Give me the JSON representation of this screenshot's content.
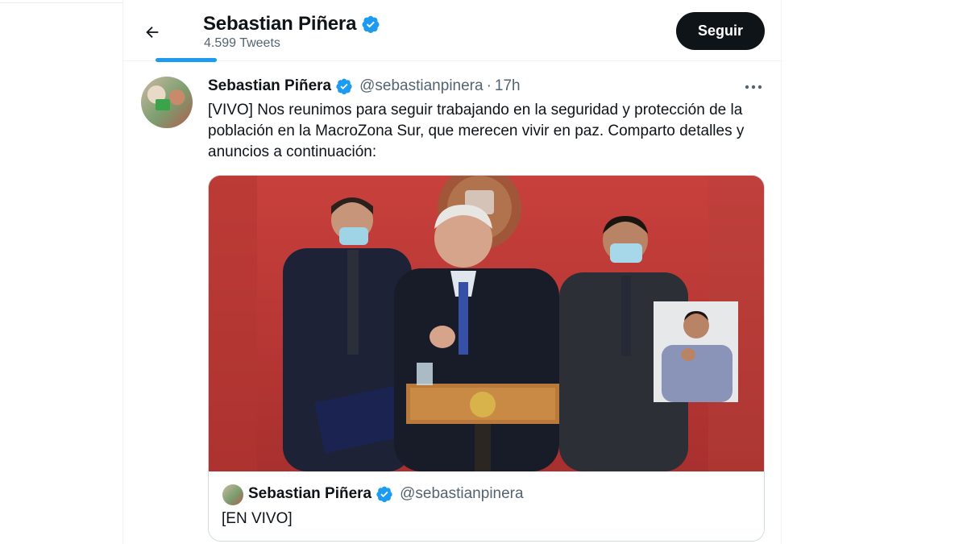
{
  "header": {
    "name": "Sebastian Piñera",
    "tweet_count": "4.599 Tweets",
    "follow_label": "Seguir",
    "back_icon": "arrow-left-icon",
    "verified_icon": "verified-badge-icon"
  },
  "tweet": {
    "author_name": "Sebastian Piñera",
    "handle": "@sebastianpinera",
    "separator": "·",
    "time": "17h",
    "more_icon": "more-horizontal-icon",
    "text": "[VIVO] Nos reunimos para seguir trabajando en la seguridad y protección de la población en la MacroZona Sur, que merecen vivir en paz. Comparto detalles y anuncios a continuación:"
  },
  "quote": {
    "author_name": "Sebastian Piñera",
    "handle": "@sebastianpinera",
    "text": "[EN VIVO]"
  },
  "colors": {
    "accent": "#1d9bf0",
    "text": "#0f1419",
    "secondary_text": "#536471",
    "follow_button": "#0f1419"
  }
}
